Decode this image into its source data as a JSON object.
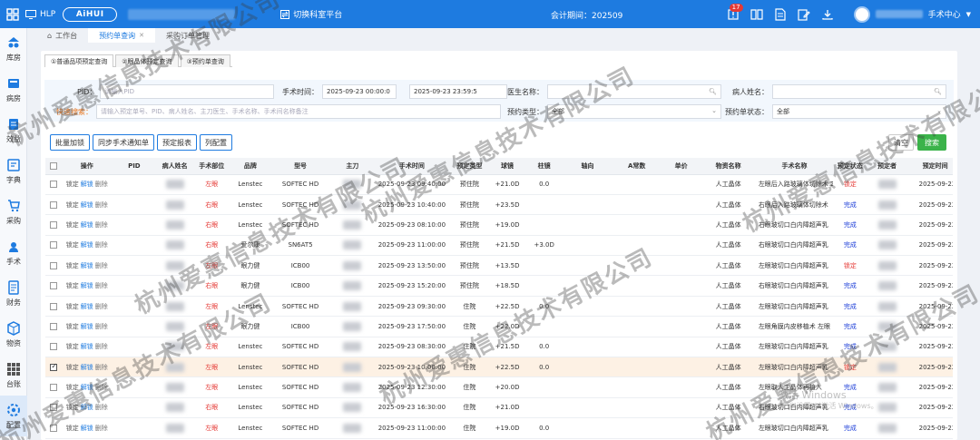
{
  "topbar": {
    "app_code": "HLP",
    "logo_text": "AiHUI",
    "switch_label": "切换科室平台",
    "period_label": "会计期间：202509",
    "notification_count": "17",
    "user_menu": "手术中心"
  },
  "sidebar": {
    "items": [
      {
        "label": "库房",
        "icon": "warehouse-icon"
      },
      {
        "label": "病房",
        "icon": "ward-icon"
      },
      {
        "label": "效益",
        "icon": "benefit-icon"
      },
      {
        "label": "字典",
        "icon": "dictionary-icon"
      },
      {
        "label": "采购",
        "icon": "purchase-icon"
      },
      {
        "label": "手术",
        "icon": "surgery-icon"
      },
      {
        "label": "财务",
        "icon": "finance-icon"
      },
      {
        "label": "物资",
        "icon": "material-icon"
      },
      {
        "label": "台账",
        "icon": "ledger-icon"
      },
      {
        "label": "配置",
        "icon": "config-icon"
      }
    ]
  },
  "tabs": [
    {
      "label": "工作台"
    },
    {
      "label": "预约单查询"
    },
    {
      "label": "采购订单管理"
    }
  ],
  "subtabs": [
    {
      "label": "①普通品项预定查询"
    },
    {
      "label": "②眼晶体预定查询"
    },
    {
      "label": "③预约单查询"
    }
  ],
  "filters": {
    "pid_label": "PID：",
    "pid_placeholder": "请输入PID",
    "surgery_time_label": "手术时间：",
    "start_time": "2025-09-23 00:00:0",
    "end_time": "2025-09-23 23:59:5",
    "doctor_label": "医生名称：",
    "patient_label": "病人姓名：",
    "quick_label": "快速搜索：",
    "quick_placeholder": "请输入预定单号、PID、病人姓名、主刀医生、手术名称、手术间名称备注",
    "type_label": "预约类型：",
    "type_value": "全部",
    "status_label": "预约单状态：",
    "status_value": "全部"
  },
  "buttons": {
    "batch_add": "批量加锁",
    "sync_notify": "同步手术通知单",
    "report": "预定报表",
    "columns": "列配置",
    "clear": "清空",
    "search": "搜索"
  },
  "table": {
    "headers": [
      "操作",
      "PID",
      "病人姓名",
      "手术部位",
      "品牌",
      "型号",
      "主刀",
      "手术时间",
      "预定类型",
      "球镜",
      "柱镜",
      "轴向",
      "A常数",
      "单价",
      "物资名称",
      "手术名称",
      "预定状态",
      "预定者",
      "预定时间"
    ],
    "op_labels": {
      "lock": "锁定",
      "unlock": "解锁",
      "delete": "删除"
    },
    "rows": [
      {
        "part": "左眼",
        "brand": "Lenstec",
        "model": "SOFTEC HD",
        "time": "2025-09-23 09:40:00",
        "type": "预住院",
        "sph": "+21.0D",
        "cyl": "0.0",
        "axis": "",
        "a": "",
        "price": "",
        "material": "人工晶体",
        "surgery": "左眼后入路玻璃体切除术 2",
        "status": "锁定",
        "booked": "2025-09-22 2"
      },
      {
        "part": "右眼",
        "brand": "Lenstec",
        "model": "SOFTEC HD",
        "time": "2025-09-23 10:40:00",
        "type": "预住院",
        "sph": "+23.5D",
        "cyl": "",
        "axis": "",
        "a": "",
        "price": "",
        "material": "人工晶体",
        "surgery": "右眼后入路玻璃体切除术",
        "status": "完成",
        "booked": "2025-09-22 1"
      },
      {
        "part": "右眼",
        "brand": "Lenstec",
        "model": "SOFTEC HD",
        "time": "2025-09-23 08:10:00",
        "type": "预住院",
        "sph": "+19.0D",
        "cyl": "",
        "axis": "",
        "a": "",
        "price": "",
        "material": "人工晶体",
        "surgery": "右眼玻切口白内障超声乳",
        "status": "完成",
        "booked": "2025-09-22 1"
      },
      {
        "part": "右眼",
        "brand": "爱尔康",
        "model": "SN6AT5",
        "time": "2025-09-23 11:00:00",
        "type": "预住院",
        "sph": "+21.5D",
        "cyl": "+3.0D",
        "axis": "",
        "a": "",
        "price": "",
        "material": "人工晶体",
        "surgery": "右眼玻切口白内障超声乳",
        "status": "完成",
        "booked": "2025-09-22 1"
      },
      {
        "part": "左眼",
        "brand": "眼力健",
        "model": "ICB00",
        "time": "2025-09-23 13:50:00",
        "type": "预住院",
        "sph": "+13.5D",
        "cyl": "",
        "axis": "",
        "a": "",
        "price": "",
        "material": "人工晶体",
        "surgery": "左眼玻切口白内障超声乳",
        "status": "锁定",
        "booked": "2025-09-22 1"
      },
      {
        "part": "右眼",
        "brand": "眼力健",
        "model": "ICB00",
        "time": "2025-09-23 15:20:00",
        "type": "预住院",
        "sph": "+18.5D",
        "cyl": "",
        "axis": "",
        "a": "",
        "price": "",
        "material": "人工晶体",
        "surgery": "右眼玻切口白内障超声乳",
        "status": "完成",
        "booked": "2025-09-22 1"
      },
      {
        "part": "左眼",
        "brand": "Lenstec",
        "model": "SOFTEC HD",
        "time": "2025-09-23 09:30:00",
        "type": "住院",
        "sph": "+22.5D",
        "cyl": "0.0",
        "axis": "",
        "a": "",
        "price": "",
        "material": "人工晶体",
        "surgery": "左眼玻切口白内障超声乳",
        "status": "完成",
        "booked": "2025-09-22 1"
      },
      {
        "part": "左眼",
        "brand": "眼力健",
        "model": "ICB00",
        "time": "2025-09-23 17:50:00",
        "type": "住院",
        "sph": "+22.0D",
        "cyl": "",
        "axis": "",
        "a": "",
        "price": "",
        "material": "人工晶体",
        "surgery": "左眼角膜内皮移植术 左眼",
        "status": "完成",
        "booked": "2025-09-22 1"
      },
      {
        "part": "左眼",
        "brand": "Lenstec",
        "model": "SOFTEC HD",
        "time": "2025-09-23 08:30:00",
        "type": "住院",
        "sph": "+21.5D",
        "cyl": "0.0",
        "axis": "",
        "a": "",
        "price": "",
        "material": "人工晶体",
        "surgery": "左眼玻切口白内障超声乳",
        "status": "完成",
        "booked": "2025-09-22 1"
      },
      {
        "part": "左眼",
        "brand": "Lenstec",
        "model": "SOFTEC HD",
        "time": "2025-09-23 10:00:00",
        "type": "住院",
        "sph": "+22.5D",
        "cyl": "0.0",
        "axis": "",
        "a": "",
        "price": "",
        "material": "人工晶体",
        "surgery": "左眼玻切口白内障超声乳",
        "status": "锁定",
        "booked": "2025-09-22 1"
      },
      {
        "part": "左眼",
        "brand": "Lenstec",
        "model": "SOFTEC HD",
        "time": "2025-09-23 12:30:00",
        "type": "住院",
        "sph": "+20.0D",
        "cyl": "",
        "axis": "",
        "a": "",
        "price": "",
        "material": "人工晶体",
        "surgery": "左眼取人工晶体再植入",
        "status": "完成",
        "booked": "2025-09-22 1"
      },
      {
        "part": "右眼",
        "brand": "Lenstec",
        "model": "SOFTEC HD",
        "time": "2025-09-23 16:30:00",
        "type": "住院",
        "sph": "+21.0D",
        "cyl": "",
        "axis": "",
        "a": "",
        "price": "",
        "material": "人工晶体",
        "surgery": "右眼玻切口白内障超声乳",
        "status": "完成",
        "booked": "2025-09-22 1"
      },
      {
        "part": "左眼",
        "brand": "Lenstec",
        "model": "SOFTEC HD",
        "time": "2025-09-23 11:00:00",
        "type": "住院",
        "sph": "+19.0D",
        "cyl": "0.0",
        "axis": "",
        "a": "",
        "price": "",
        "material": "人工晶体",
        "surgery": "左眼玻切口白内障超声乳",
        "status": "完成",
        "booked": "2025-09-22 1"
      }
    ]
  },
  "watermark_text": "杭州爱惠信息技术有限公司",
  "os_notice": {
    "line1": "激活 Windows",
    "line2": "转到\"设置\"以激活 Windows。"
  },
  "colors": {
    "primary": "#1e7be0",
    "danger": "#e53935",
    "success": "#3bb34a",
    "highlight_row": "#fdf1e4"
  }
}
